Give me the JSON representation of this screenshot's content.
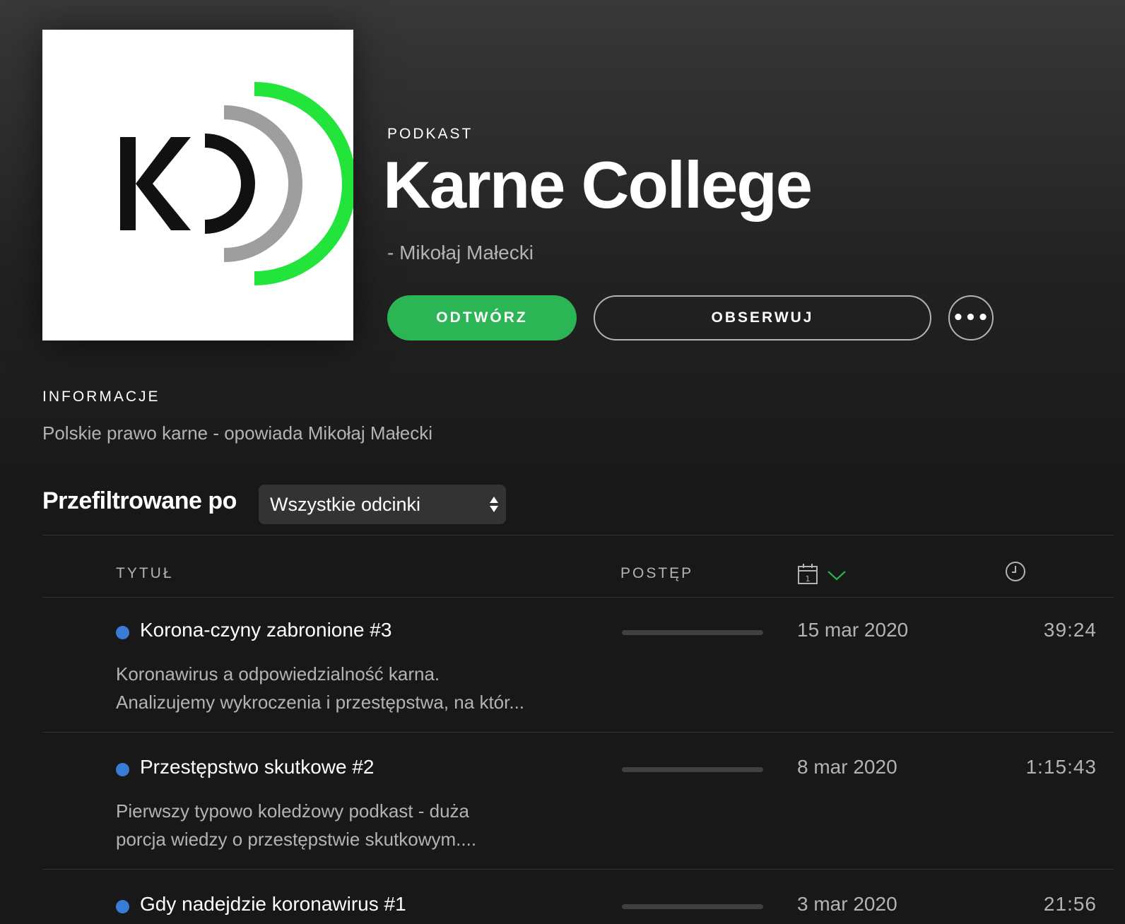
{
  "podcast": {
    "type_label": "PODKAST",
    "title": "Karne College",
    "author": "- Mikołaj Małecki",
    "cover_icon": "karne-college-logo",
    "cover_logo_colors": {
      "letter": "#111111",
      "gray_arc": "#9e9e9e",
      "green_arc": "#22e43a"
    }
  },
  "actions": {
    "play_label": "ODTWÓRZ",
    "follow_label": "OBSERWUJ",
    "more_label": "•••",
    "accent_color": "#2cb555"
  },
  "info": {
    "heading": "INFORMACJE",
    "description": "Polskie prawo karne - opowiada Mikołaj Małecki"
  },
  "filter": {
    "label": "Przefiltrowane po",
    "selected": "Wszystkie odcinki"
  },
  "table": {
    "columns": {
      "title": "TYTUŁ",
      "progress": "POSTĘP",
      "date_icon": "calendar-icon",
      "sort_icon": "chevron-down-icon",
      "duration_icon": "clock-icon"
    },
    "episodes": [
      {
        "title": "Korona-czyny zabronione #3",
        "desc_line1": "Koronawirus a odpowiedzialność karna.",
        "desc_line2": "Analizujemy wykroczenia i przestępstwa, na któr...",
        "progress": 0,
        "date": "15 mar 2020",
        "duration": "39:24",
        "unplayed_color": "#3a7bd5"
      },
      {
        "title": "Przestępstwo skutkowe #2",
        "desc_line1": "Pierwszy typowo koledżowy podkast - duża",
        "desc_line2": "porcja wiedzy o przestępstwie skutkowym....",
        "progress": 0,
        "date": "8 mar 2020",
        "duration": "1:15:43",
        "unplayed_color": "#3a7bd5"
      },
      {
        "title": "Gdy nadejdzie koronawirus #1",
        "desc_line1": "",
        "desc_line2": "",
        "progress": 0,
        "date": "3 mar 2020",
        "duration": "21:56",
        "unplayed_color": "#3a7bd5"
      }
    ]
  }
}
